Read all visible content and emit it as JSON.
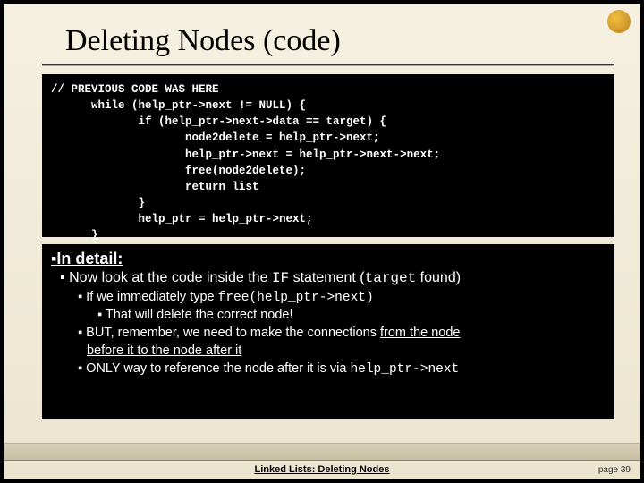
{
  "title": "Deleting Nodes (code)",
  "code": "// PREVIOUS CODE WAS HERE\n      while (help_ptr->next != NULL) {\n             if (help_ptr->next->data == target) {\n                    node2delete = help_ptr->next;\n                    help_ptr->next = help_ptr->next->next;\n                    free(node2delete);\n                    return list\n             }\n             help_ptr = help_ptr->next;\n      }",
  "detail": {
    "heading": "In detail:",
    "l1_a": "Now look at the code inside the ",
    "l1_if": "IF",
    "l1_b": " statement (",
    "l1_target": "target",
    "l1_c": " found)",
    "l2a_a": "If we immediately type ",
    "l2a_code": "free(help_ptr->next)",
    "l3a": "That will delete the correct node!",
    "l2b_a": "BUT, remember, we need to make the connections ",
    "l2b_u": "from the node",
    "l2b_cont": "before it to the node after it",
    "l2c_a": "ONLY  way to reference the node after it is via ",
    "l2c_code": "help_ptr->next"
  },
  "footer": {
    "title": "Linked Lists:  Deleting Nodes",
    "page": "page 39"
  }
}
